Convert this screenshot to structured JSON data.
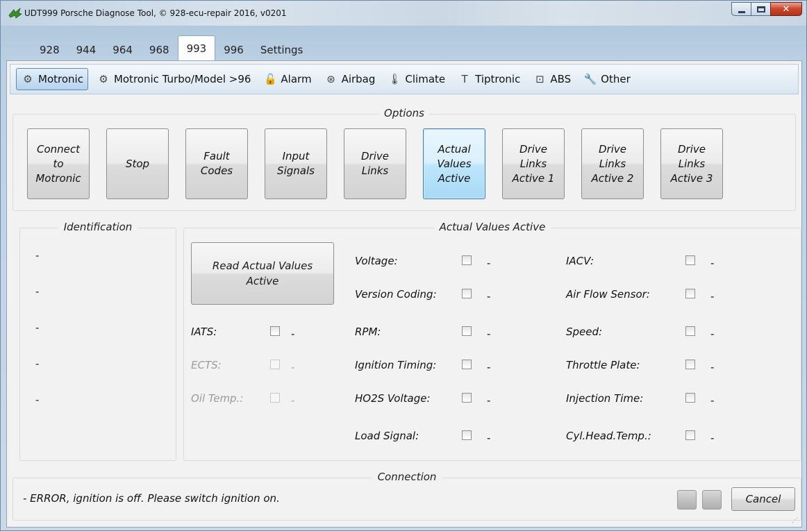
{
  "window": {
    "title": "UDT999 Porsche Diagnose Tool, © 928-ecu-repair 2016, v0201"
  },
  "tabs": [
    "928",
    "944",
    "964",
    "968",
    "993",
    "996",
    "Settings"
  ],
  "active_tab": "993",
  "subtabs": [
    {
      "label": "Motronic",
      "icon": "engine-icon",
      "glyph": "⚙"
    },
    {
      "label": "Motronic Turbo/Model >96",
      "icon": "engine-icon",
      "glyph": "⚙"
    },
    {
      "label": "Alarm",
      "icon": "padlock-icon",
      "glyph": "🔓"
    },
    {
      "label": "Airbag",
      "icon": "steering-wheel-icon",
      "glyph": "⊛"
    },
    {
      "label": "Climate",
      "icon": "thermometer-icon",
      "glyph": "🌡"
    },
    {
      "label": "Tiptronic",
      "icon": "tiptronic-t-icon",
      "glyph": "T"
    },
    {
      "label": "ABS",
      "icon": "abs-icon",
      "glyph": "⊡"
    },
    {
      "label": "Other",
      "icon": "wrench-icon",
      "glyph": "🔧"
    }
  ],
  "active_subtab": "Motronic",
  "options": {
    "title": "Options",
    "buttons": [
      {
        "label": "Connect\nto\nMotronic",
        "active": false
      },
      {
        "label": "Stop",
        "active": false
      },
      {
        "label": "Fault\nCodes",
        "active": false
      },
      {
        "label": "Input\nSignals",
        "active": false
      },
      {
        "label": "Drive\nLinks",
        "active": false
      },
      {
        "label": "Actual\nValues\nActive",
        "active": true
      },
      {
        "label": "Drive\nLinks\nActive 1",
        "active": false
      },
      {
        "label": "Drive\nLinks\nActive 2",
        "active": false
      },
      {
        "label": "Drive\nLinks\nActive 3",
        "active": false
      }
    ]
  },
  "identification": {
    "title": "Identification",
    "values": [
      "-",
      "-",
      "-",
      "-",
      "-"
    ]
  },
  "actual_values": {
    "title": "Actual Values Active",
    "read_button": "Read Actual Values Active",
    "left": [
      {
        "label": "IATS:",
        "value": "-",
        "enabled": true
      },
      {
        "label": "ECTS:",
        "value": "-",
        "enabled": false
      },
      {
        "label": "Oil Temp.:",
        "value": "-",
        "enabled": false
      }
    ],
    "middle": [
      {
        "label": "Voltage:",
        "value": "-"
      },
      {
        "label": "Version Coding:",
        "value": "-"
      },
      {
        "label": "RPM:",
        "value": "-"
      },
      {
        "label": "Ignition Timing:",
        "value": "-"
      },
      {
        "label": "HO2S Voltage:",
        "value": "-"
      },
      {
        "label": "Load Signal:",
        "value": "-"
      }
    ],
    "right": [
      {
        "label": "IACV:",
        "value": "-"
      },
      {
        "label": "Air Flow Sensor:",
        "value": "-"
      },
      {
        "label": "Speed:",
        "value": "-"
      },
      {
        "label": "Throttle Plate:",
        "value": "-"
      },
      {
        "label": "Injection Time:",
        "value": "-"
      },
      {
        "label": "Cyl.Head.Temp.:",
        "value": "-"
      }
    ]
  },
  "connection": {
    "title": "Connection",
    "status": "-  ERROR, ignition is off. Please switch ignition on.",
    "cancel_label": "Cancel"
  }
}
